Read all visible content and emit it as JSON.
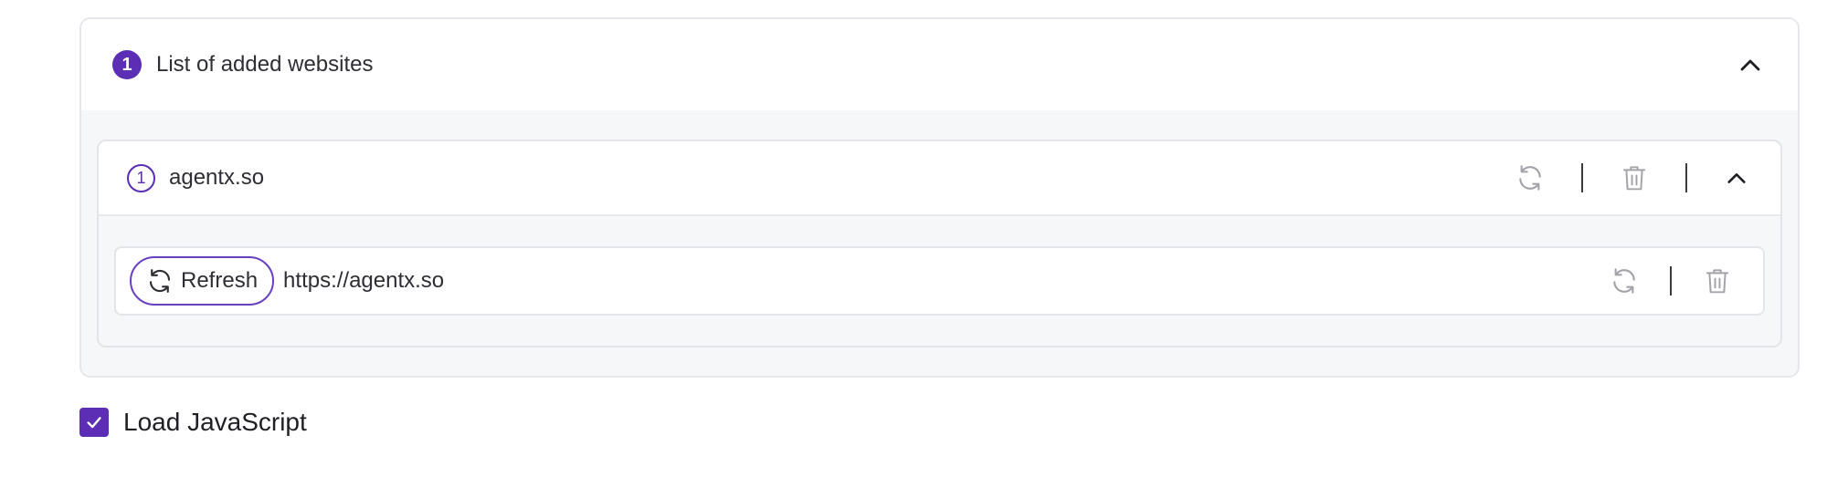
{
  "websites_section": {
    "index": "1",
    "title": "List of added websites"
  },
  "sites": [
    {
      "index": "1",
      "name": "agentx.so",
      "urls": [
        {
          "refresh_label": "Refresh",
          "url": "https://agentx.so"
        }
      ]
    }
  ],
  "load_js": {
    "label": "Load JavaScript",
    "checked": true
  },
  "colors": {
    "accent": "#5b2eb5",
    "icon_gray": "#a3a3ab",
    "panel_bg": "#f6f7f8",
    "border": "#e3e5ea"
  },
  "icons": {
    "collapse": "chevron-up-icon",
    "sync": "sync-icon",
    "delete": "trash-icon",
    "check": "check-icon"
  }
}
